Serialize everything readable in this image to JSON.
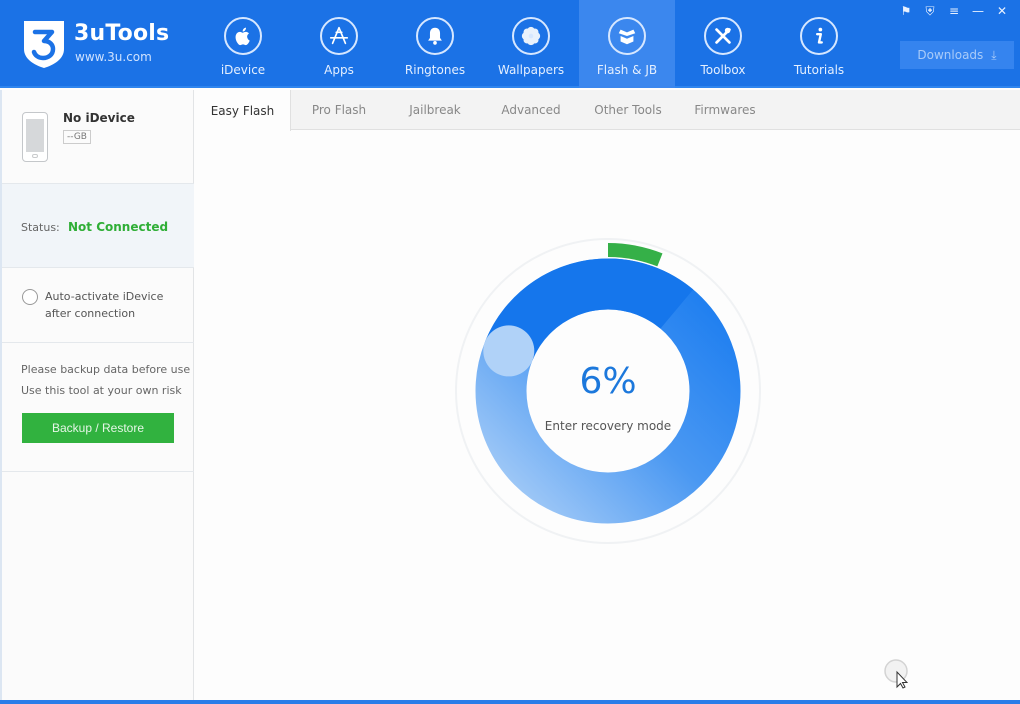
{
  "app": {
    "name": "3uTools",
    "url": "www.3u.com",
    "brand_color": "#1b72e6"
  },
  "nav": {
    "items": [
      {
        "label": "iDevice",
        "icon": "apple-icon",
        "active": false
      },
      {
        "label": "Apps",
        "icon": "app-store-icon",
        "active": false
      },
      {
        "label": "Ringtones",
        "icon": "bell-icon",
        "active": false
      },
      {
        "label": "Wallpapers",
        "icon": "flower-icon",
        "active": false
      },
      {
        "label": "Flash & JB",
        "icon": "box-icon",
        "active": true
      },
      {
        "label": "Toolbox",
        "icon": "tools-icon",
        "active": false
      },
      {
        "label": "Tutorials",
        "icon": "info-icon",
        "active": false
      }
    ],
    "downloads_label": "Downloads"
  },
  "window_controls": [
    "feedback-icon",
    "skin-icon",
    "menu-icon",
    "minimize-icon",
    "close-icon"
  ],
  "sidebar": {
    "device_name": "No iDevice",
    "capacity": "--GB",
    "status_label": "Status:",
    "status_value": "Not Connected",
    "status_color": "#2fae36",
    "auto_activate_line1": "Auto-activate iDevice",
    "auto_activate_line2": "after connection",
    "auto_activate_checked": false,
    "warning_line1": "Please backup data before use",
    "warning_line2": "Use this tool at your own risk",
    "backup_button": "Backup / Restore"
  },
  "tabs": [
    {
      "label": "Easy Flash",
      "active": true
    },
    {
      "label": "Pro Flash",
      "active": false
    },
    {
      "label": "Jailbreak",
      "active": false
    },
    {
      "label": "Advanced",
      "active": false
    },
    {
      "label": "Other Tools",
      "active": false
    },
    {
      "label": "Firmwares",
      "active": false
    }
  ],
  "progress": {
    "percent_text": "6%",
    "percent": 6,
    "step": "Enter recovery mode",
    "accent_color": "#35b048"
  }
}
